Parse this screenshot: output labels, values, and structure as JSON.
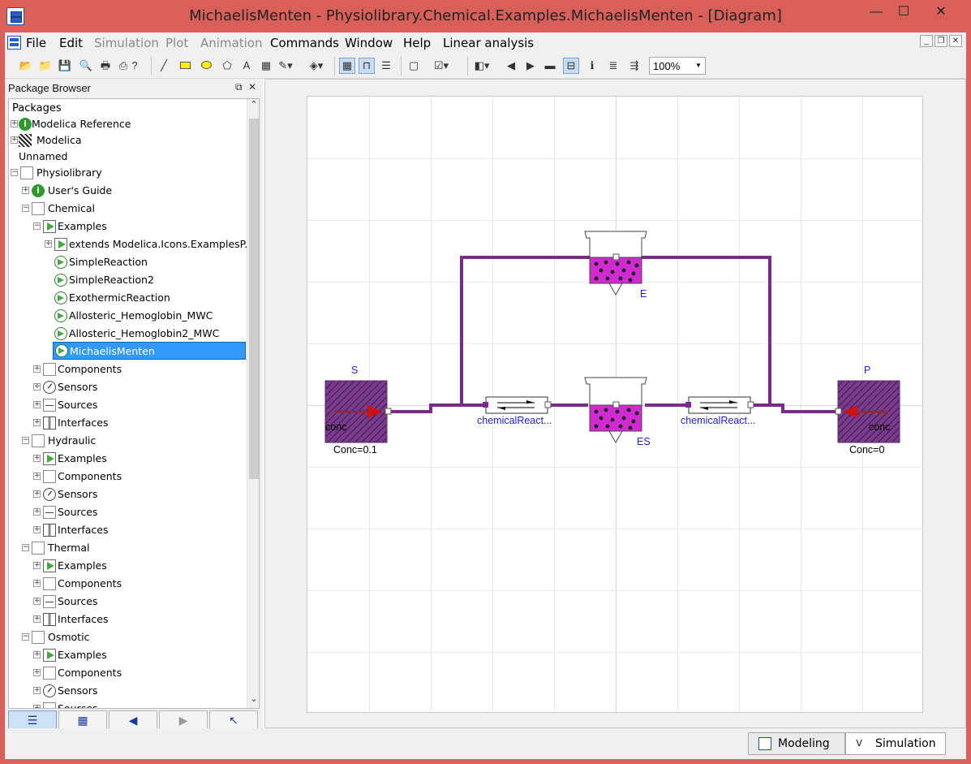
{
  "window": {
    "title": "MichaelisMenten - Physiolibrary.Chemical.Examples.MichaelisMenten  - [Diagram]",
    "minimize": "—",
    "maximize": "☐",
    "close": "✕"
  },
  "menu": {
    "items": [
      "File",
      "Edit",
      "Simulation",
      "Plot",
      "Animation",
      "Commands",
      "Window",
      "Help",
      "Linear analysis"
    ],
    "disabled": [
      "Simulation",
      "Plot",
      "Animation"
    ]
  },
  "toolbar": {
    "zoom_value": "100%"
  },
  "package_browser": {
    "title": "Package Browser",
    "tree_header": "Packages",
    "items": [
      {
        "label": "Modelica Reference"
      },
      {
        "label": "Modelica"
      },
      {
        "label": "Unnamed"
      },
      {
        "label": "Physiolibrary"
      },
      {
        "label": "User's Guide"
      },
      {
        "label": "Chemical"
      },
      {
        "label": "Examples"
      },
      {
        "label": "extends Modelica.Icons.ExamplesP..."
      },
      {
        "label": "SimpleReaction"
      },
      {
        "label": "SimpleReaction2"
      },
      {
        "label": "ExothermicReaction"
      },
      {
        "label": "Allosteric_Hemoglobin_MWC"
      },
      {
        "label": "Allosteric_Hemoglobin2_MWC"
      },
      {
        "label": "MichaelisMenten"
      },
      {
        "label": "Components"
      },
      {
        "label": "Sensors"
      },
      {
        "label": "Sources"
      },
      {
        "label": "Interfaces"
      },
      {
        "label": "Hydraulic"
      },
      {
        "label": "Examples"
      },
      {
        "label": "Components"
      },
      {
        "label": "Sensors"
      },
      {
        "label": "Sources"
      },
      {
        "label": "Interfaces"
      },
      {
        "label": "Thermal"
      },
      {
        "label": "Examples"
      },
      {
        "label": "Components"
      },
      {
        "label": "Sources"
      },
      {
        "label": "Interfaces"
      },
      {
        "label": "Osmotic"
      },
      {
        "label": "Examples"
      },
      {
        "label": "Components"
      },
      {
        "label": "Sensors"
      },
      {
        "label": "Sources"
      }
    ]
  },
  "diagram": {
    "components": {
      "S": {
        "name": "S",
        "inner": "conc",
        "param": "Conc=0.1"
      },
      "P": {
        "name": "P",
        "inner": "conc",
        "param": "Conc=0"
      },
      "E": {
        "name": "E"
      },
      "ES": {
        "name": "ES"
      },
      "reaction1": {
        "name": "chemicalReact..."
      },
      "reaction2": {
        "name": "chemicalReact..."
      }
    },
    "colors": {
      "connection": "#7a2a8c",
      "substance_fill": "#7a3a8c",
      "beaker_fill": "#d22ad2",
      "label_blue": "#2222cc",
      "arrow_red": "#cc1111"
    }
  },
  "bottom_tabs": {
    "modeling": "Modeling",
    "simulation": "Simulation"
  }
}
